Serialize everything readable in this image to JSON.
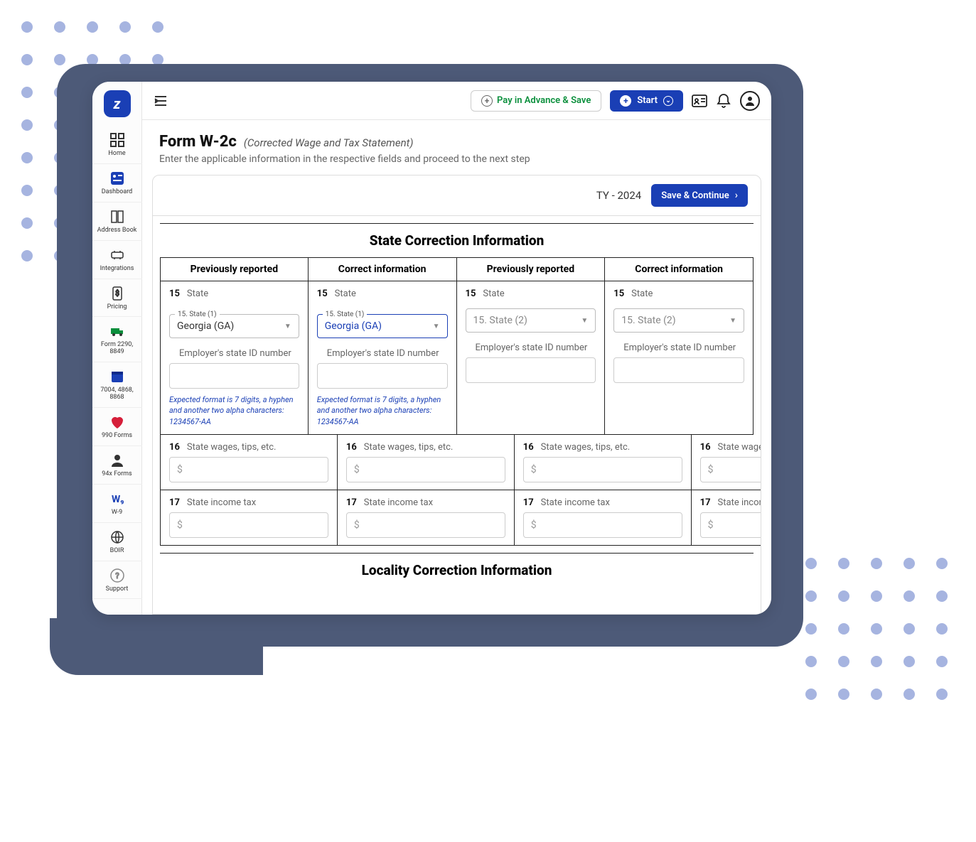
{
  "sidebar": {
    "items": [
      {
        "label": "Home"
      },
      {
        "label": "Dashboard"
      },
      {
        "label": "Address Book"
      },
      {
        "label": "Integrations"
      },
      {
        "label": "Pricing"
      },
      {
        "label": "Form 2290, 8849"
      },
      {
        "label": "7004, 4868, 8868"
      },
      {
        "label": "990 Forms"
      },
      {
        "label": "94x Forms"
      },
      {
        "label": "W-9"
      },
      {
        "label": "BOIR"
      },
      {
        "label": "Support"
      }
    ]
  },
  "topbar": {
    "pay_label": "Pay in Advance & Save",
    "start_label": "Start"
  },
  "page": {
    "title": "Form W-2c",
    "subtitle": "(Corrected Wage and Tax Statement)",
    "desc": "Enter the applicable information in the respective fields and proceed to the next step"
  },
  "panel": {
    "tax_year": "TY - 2024",
    "save_continue": "Save & Continue",
    "section1_title": "State Correction Information",
    "section2_title": "Locality Correction Information",
    "col_prev": "Previously reported",
    "col_corr": "Correct information",
    "box15_label": "State",
    "box15_num": "15",
    "state1_legend": "15. State (1)",
    "state2_legend": "15. State (2)",
    "state1_value": "Georgia (GA)",
    "state2_placeholder": "15. State (2)",
    "emp_id_label": "Employer's state ID number",
    "hint_text": "Expected format is 7 digits, a hyphen and another two alpha characters: 1234567-AA",
    "box16_num": "16",
    "box16_label": "State wages, tips, etc.",
    "box17_num": "17",
    "box17_label": "State income tax",
    "currency": "$"
  }
}
